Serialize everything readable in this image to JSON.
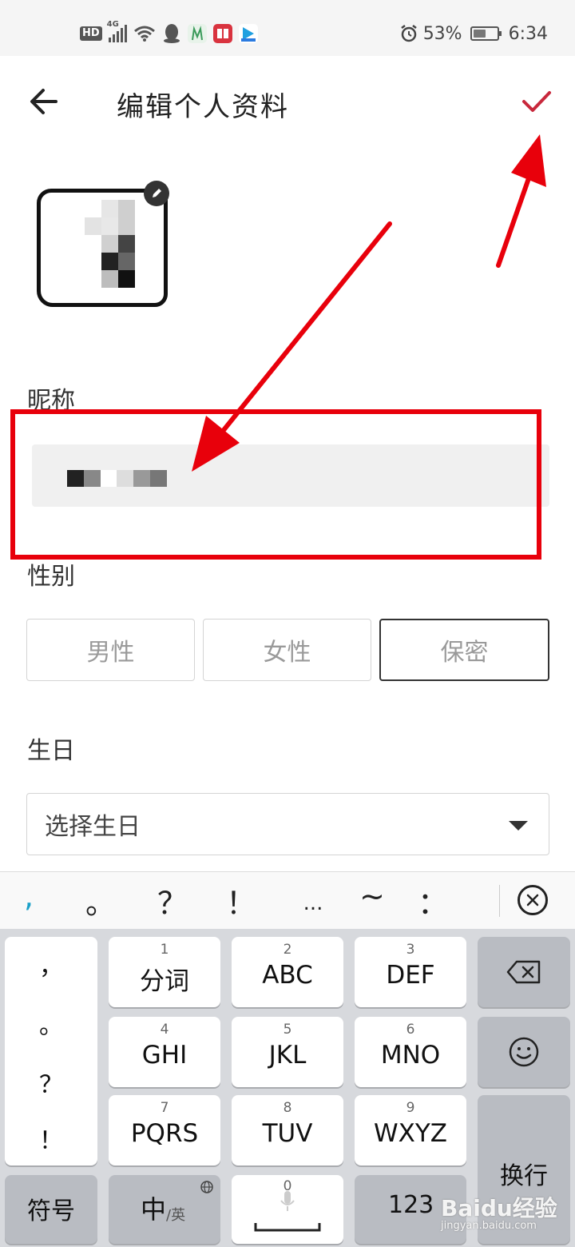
{
  "status_bar": {
    "left_badges": [
      "HD",
      "4G"
    ],
    "icons": [
      "signal-icon",
      "wifi-icon",
      "qq-icon",
      "app-icon",
      "book-app-icon",
      "video-app-icon"
    ],
    "battery_percent": "53%",
    "battery_level": 0.53,
    "time": "6:34",
    "alarm_icon": "alarm-icon"
  },
  "header": {
    "back_icon": "arrow-left-icon",
    "title": "编辑个人资料",
    "confirm_icon": "check-icon",
    "confirm_color": "#c8283c"
  },
  "form": {
    "nickname_label": "昵称",
    "gender_label": "性别",
    "gender_options": [
      "男性",
      "女性",
      "保密"
    ],
    "gender_selected": "保密",
    "birthday_label": "生日",
    "birthday_placeholder": "选择生日"
  },
  "annotation": {
    "color": "#e8000b"
  },
  "keyboard": {
    "punct_row": [
      ",",
      "。",
      "？",
      "！",
      "...",
      "~",
      "："
    ],
    "punct_first_color": "#1aa0c8",
    "side_keys": [
      "，",
      "。",
      "？",
      "！"
    ],
    "keys": [
      {
        "num": "1",
        "label": "分词"
      },
      {
        "num": "2",
        "label": "ABC"
      },
      {
        "num": "3",
        "label": "DEF"
      },
      {
        "num": "4",
        "label": "GHI"
      },
      {
        "num": "5",
        "label": "JKL"
      },
      {
        "num": "6",
        "label": "MNO"
      },
      {
        "num": "7",
        "label": "PQRS"
      },
      {
        "num": "8",
        "label": "TUV"
      },
      {
        "num": "9",
        "label": "WXYZ"
      }
    ],
    "symbols_label": "符号",
    "lang_main": "中",
    "lang_sub": "/英",
    "space_num": "0",
    "numbers_label": "123",
    "enter_label": "换行"
  },
  "watermark": {
    "main": "Baidu经验",
    "sub": "jingyan.baidu.com"
  }
}
